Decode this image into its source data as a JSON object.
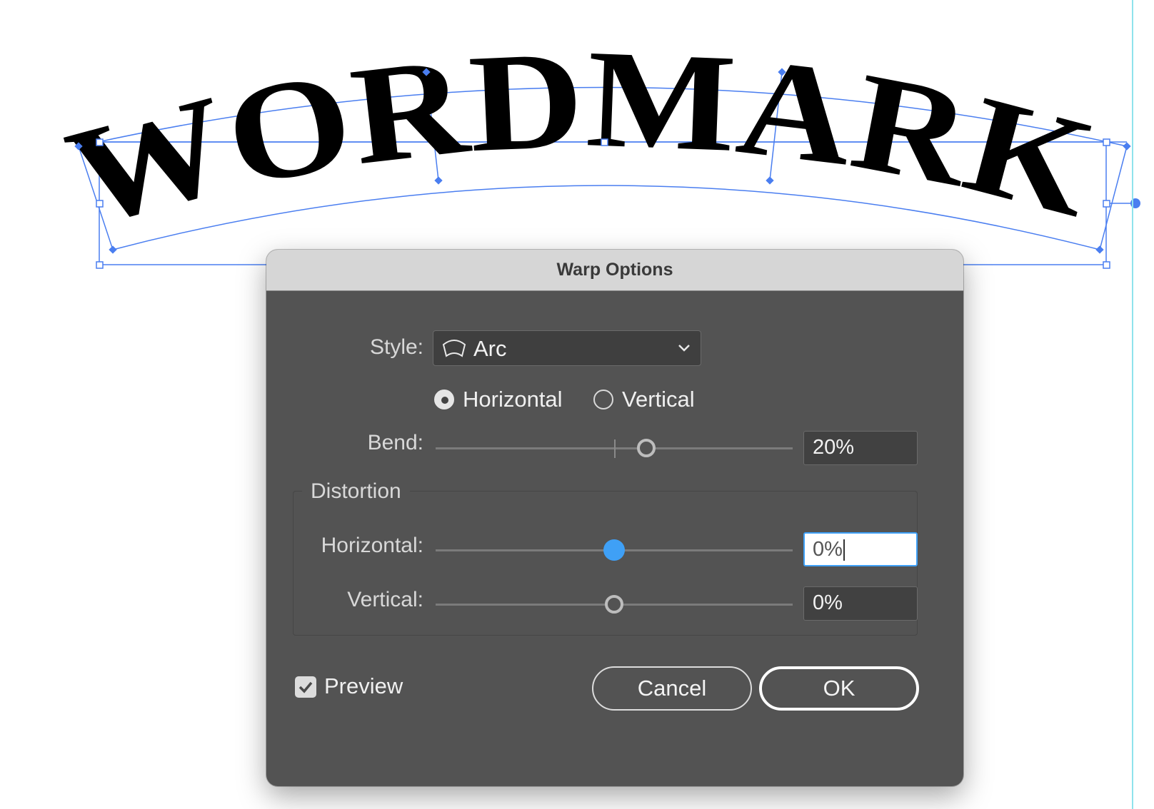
{
  "artboard": {
    "wordmark_text": "WORDMARK",
    "selection_color": "#4a7ef0",
    "guide_color": "#8fe3ec"
  },
  "dialog": {
    "title": "Warp Options",
    "style": {
      "label": "Style:",
      "value": "Arc",
      "icon": "arc-warp-icon"
    },
    "orientation": {
      "options": [
        "Horizontal",
        "Vertical"
      ],
      "selected": "Horizontal"
    },
    "bend": {
      "label": "Bend:",
      "value": "20%",
      "percent": 20
    },
    "distortion": {
      "title": "Distortion",
      "horizontal": {
        "label": "Horizontal:",
        "value": "0%",
        "percent": 0
      },
      "vertical": {
        "label": "Vertical:",
        "value": "0%",
        "percent": 0
      }
    },
    "preview": {
      "label": "Preview",
      "checked": true
    },
    "buttons": {
      "cancel": "Cancel",
      "ok": "OK"
    },
    "accent_color": "#3fa0f6"
  }
}
